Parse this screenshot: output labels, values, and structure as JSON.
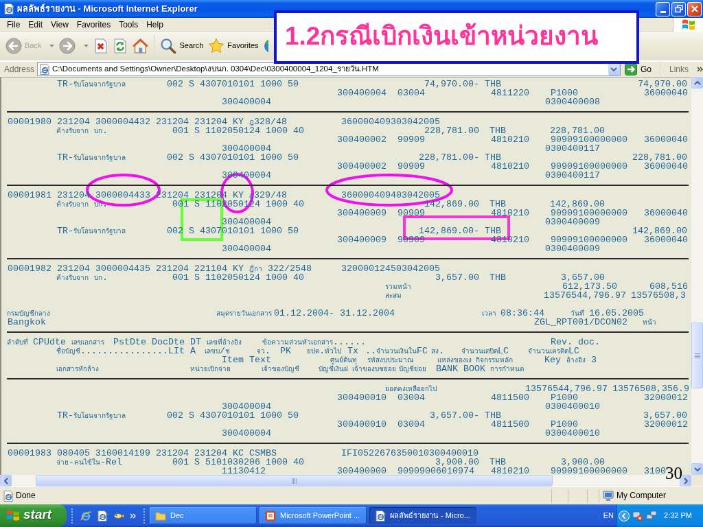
{
  "window": {
    "title": "ผลลัพธ์รายงาน - Microsoft Internet Explorer"
  },
  "menu": [
    "File",
    "Edit",
    "View",
    "Favorites",
    "Tools",
    "Help"
  ],
  "toolbar": [
    {
      "kind": "back",
      "label": "Back",
      "disabled": true
    },
    {
      "kind": "forward",
      "disabled": true
    },
    {
      "kind": "stop",
      "disabled": false
    },
    {
      "kind": "refresh",
      "disabled": false
    },
    {
      "kind": "home",
      "disabled": false
    },
    {
      "kind": "search",
      "label": "Search",
      "disabled": false
    },
    {
      "kind": "favorites",
      "label": "Favorites",
      "disabled": false
    },
    {
      "kind": "media",
      "disabled": false
    }
  ],
  "address": {
    "label": "Address",
    "value": "C:\\Documents and Settings\\Owner\\Desktop\\งบนก. 0304\\Dec\\0300400004_1204_รายวัน.HTM",
    "go": "Go",
    "links": "Links"
  },
  "report": {
    "sections": [
      {
        "lines": [
          {
            "kind": "credit",
            "cells": [
              "TR-รับโอนจากรัฐบาล",
              "002 S 4307010101 1000 50",
              "74,970.00- THB",
              "74,970.00"
            ]
          },
          {
            "kind": "detail",
            "cells": [
              "300400004",
              "03004",
              "4811220",
              "P1000",
              "36000040"
            ]
          },
          {
            "kind": "ref",
            "cells": [
              "300400004",
              "0300400008"
            ]
          }
        ]
      },
      {
        "lines": [
          {
            "kind": "doc",
            "cells": [
              "00001980 231204 3000004432 231204 231204 KY ฎ328/48",
              "360000409303042005"
            ]
          },
          {
            "kind": "debit",
            "cells": [
              "ค้างรับจาก บก.",
              "001 S 1102050124 1000 40",
              "228,781.00",
              "THB",
              "228,781.00"
            ]
          },
          {
            "kind": "detail",
            "cells": [
              "300400002",
              "90909",
              "4810210",
              "90909100000000",
              "36000040"
            ]
          },
          {
            "kind": "ref",
            "cells": [
              "300400004",
              "0300400117"
            ]
          },
          {
            "kind": "credit",
            "cells": [
              "TR-รับโอนจากรัฐบาล",
              "002 S 4307010101 1000 50",
              "228,781.00- THB",
              "228,781.00"
            ]
          },
          {
            "kind": "detail",
            "cells": [
              "300400002",
              "90909",
              "4810210",
              "90909100000000",
              "36000040"
            ]
          },
          {
            "kind": "ref",
            "cells": [
              "300400004",
              "0300400117"
            ]
          }
        ]
      },
      {
        "lines": [
          {
            "kind": "doc",
            "cells": [
              "00001981 231204 3000004433 231204 231204 KY ฎ329/48",
              "360000409403042005"
            ]
          },
          {
            "kind": "debit",
            "cells": [
              "ค้างรับจาก บก.",
              "001 S 1102050124 1000 40",
              "142,869.00",
              "THB",
              "142,869.00"
            ]
          },
          {
            "kind": "detail",
            "cells": [
              "300400009",
              "90909",
              "4810210",
              "90909100000000",
              "36000040"
            ]
          },
          {
            "kind": "ref",
            "cells": [
              "300400004",
              "0300400009"
            ]
          },
          {
            "kind": "credit",
            "cells": [
              "TR-รับโอนจากรัฐบาล",
              "002 S 4307010101 1000 50",
              "142,869.00- THB",
              "142,869.00"
            ]
          },
          {
            "kind": "detail",
            "cells": [
              "300400009",
              "90909",
              "4810210",
              "90909100000000",
              "36000040"
            ]
          },
          {
            "kind": "ref",
            "cells": [
              "300400004",
              "0300400009"
            ]
          }
        ]
      },
      {
        "lines": [
          {
            "kind": "doc",
            "cells": [
              "00001982 231204 3000004435 231204 221104 KY ฎีกา 322/2548",
              "320000124503042005"
            ]
          },
          {
            "kind": "debit",
            "cells": [
              "ค้างรับจาก บก.",
              "001 S 1102050124 1000 40",
              "3,657.00",
              "THB",
              "3,657.00"
            ]
          },
          {
            "kind": "page_total",
            "cells": [
              "รวมหน้า",
              "612,173.50",
              "608,516"
            ]
          },
          {
            "kind": "cumulative",
            "cells": [
              "สะสม",
              "13576544,796.97",
              "13576508,3"
            ]
          },
          {
            "kind": "title",
            "cells": [
              "กรมบัญชีกลาง",
              "สมุดรายวันเอกสาร",
              "01.12.2004- 31.12.2004",
              "เวลา",
              "08:36:44",
              "วันที่",
              "16.05.2005"
            ]
          },
          {
            "kind": "subtitle",
            "cells": [
              "Bangkok",
              "ZGL_RPT001/DCON02",
              "หน้า"
            ]
          }
        ]
      },
      {
        "lines": [
          {
            "kind": "head_1",
            "cells": [
              "ลำดับที่",
              "CPUdte",
              "เลขเอกสาร",
              "PstDte DocDte DT",
              "เลขที่อ้างอิง",
              "ข้อความส่วนหัวเอกสาร......",
              "Rev. doc."
            ]
          },
          {
            "kind": "head_2",
            "cells": [
              "ชื่อบัญชี................LIt A",
              "เลขบ/ช",
              "จว.",
              "PK",
              "ยปด.ทั่วไป",
              "Tx",
              "..จำนวนเงินในFC",
              "สง.",
              "จำนวนเดบิตLC",
              "จำนวนเครดิตLC"
            ]
          },
          {
            "kind": "head_3",
            "cells": [
              "Item Text",
              "ศูนย์ต้นทุ",
              "รหัสงบประมาณ",
              "แหล่งของเง",
              "กิจกรรมหลัก",
              "Key อ้างอิง 3"
            ]
          },
          {
            "kind": "head_4",
            "cells": [
              "เอกสารหักล้าง",
              "หน่วยเบิกจ่าย",
              "เจ้าของบัญชี",
              "บัญชีเงินฝ",
              "เจ้าของบชย่อย",
              "บัญชีย่อย",
              "BANK BOOK",
              "การกำหนด"
            ]
          }
        ]
      },
      {
        "lines": [
          {
            "kind": "carry",
            "cells": [
              "ยอดคงเหลือยกไป",
              "13576544,796.97",
              "13576508,356.9"
            ]
          },
          {
            "kind": "detail",
            "cells": [
              "300400010",
              "03004",
              "4811500",
              "P1000",
              "32000012"
            ]
          },
          {
            "kind": "ref",
            "cells": [
              "300400004",
              "0300400010"
            ]
          },
          {
            "kind": "credit",
            "cells": [
              "TR-รับโอนจากรัฐบาล",
              "002 S 4307010101 1000 50",
              "3,657.00- THB",
              "3,657.00"
            ]
          },
          {
            "kind": "detail",
            "cells": [
              "300400010",
              "03004",
              "4811500",
              "P1000",
              "32000012"
            ]
          },
          {
            "kind": "ref",
            "cells": [
              "300400004",
              "0300400010"
            ]
          }
        ]
      },
      {
        "lines": [
          {
            "kind": "doc",
            "cells": [
              "00001983 080405 3100014199 231204 231204 KC CSMBS",
              "IFI0522676350010300400010"
            ]
          },
          {
            "kind": "debit",
            "cells": [
              "จ่าย-คนไข้ใน-Rel",
              "001 S 5101030206 1000 40",
              "3,900.00",
              "THB",
              "3,900.00"
            ]
          },
          {
            "kind": "detail_ref",
            "cells": [
              "11130412",
              "300400000",
              "90909006010974",
              "4810210",
              "90909100000000",
              "3100"
            ]
          }
        ]
      }
    ]
  },
  "slide": {
    "heading": "1.2กรณีเบิกเงินเข้าหน่วยงาน",
    "page_number": "30"
  },
  "status_bar": {
    "text": "Done",
    "zone": "My Computer"
  },
  "taskbar": {
    "start": "start",
    "tasks": [
      {
        "kind": "folder",
        "label": "Dec",
        "selected": false
      },
      {
        "kind": "powerpoint",
        "label": "Microsoft PowerPoint ...",
        "selected": false
      },
      {
        "kind": "browser",
        "label": "ผลลัพธ์รายงาน - Micro...",
        "selected": true
      }
    ],
    "language": "EN",
    "clock": "2:32 PM"
  }
}
